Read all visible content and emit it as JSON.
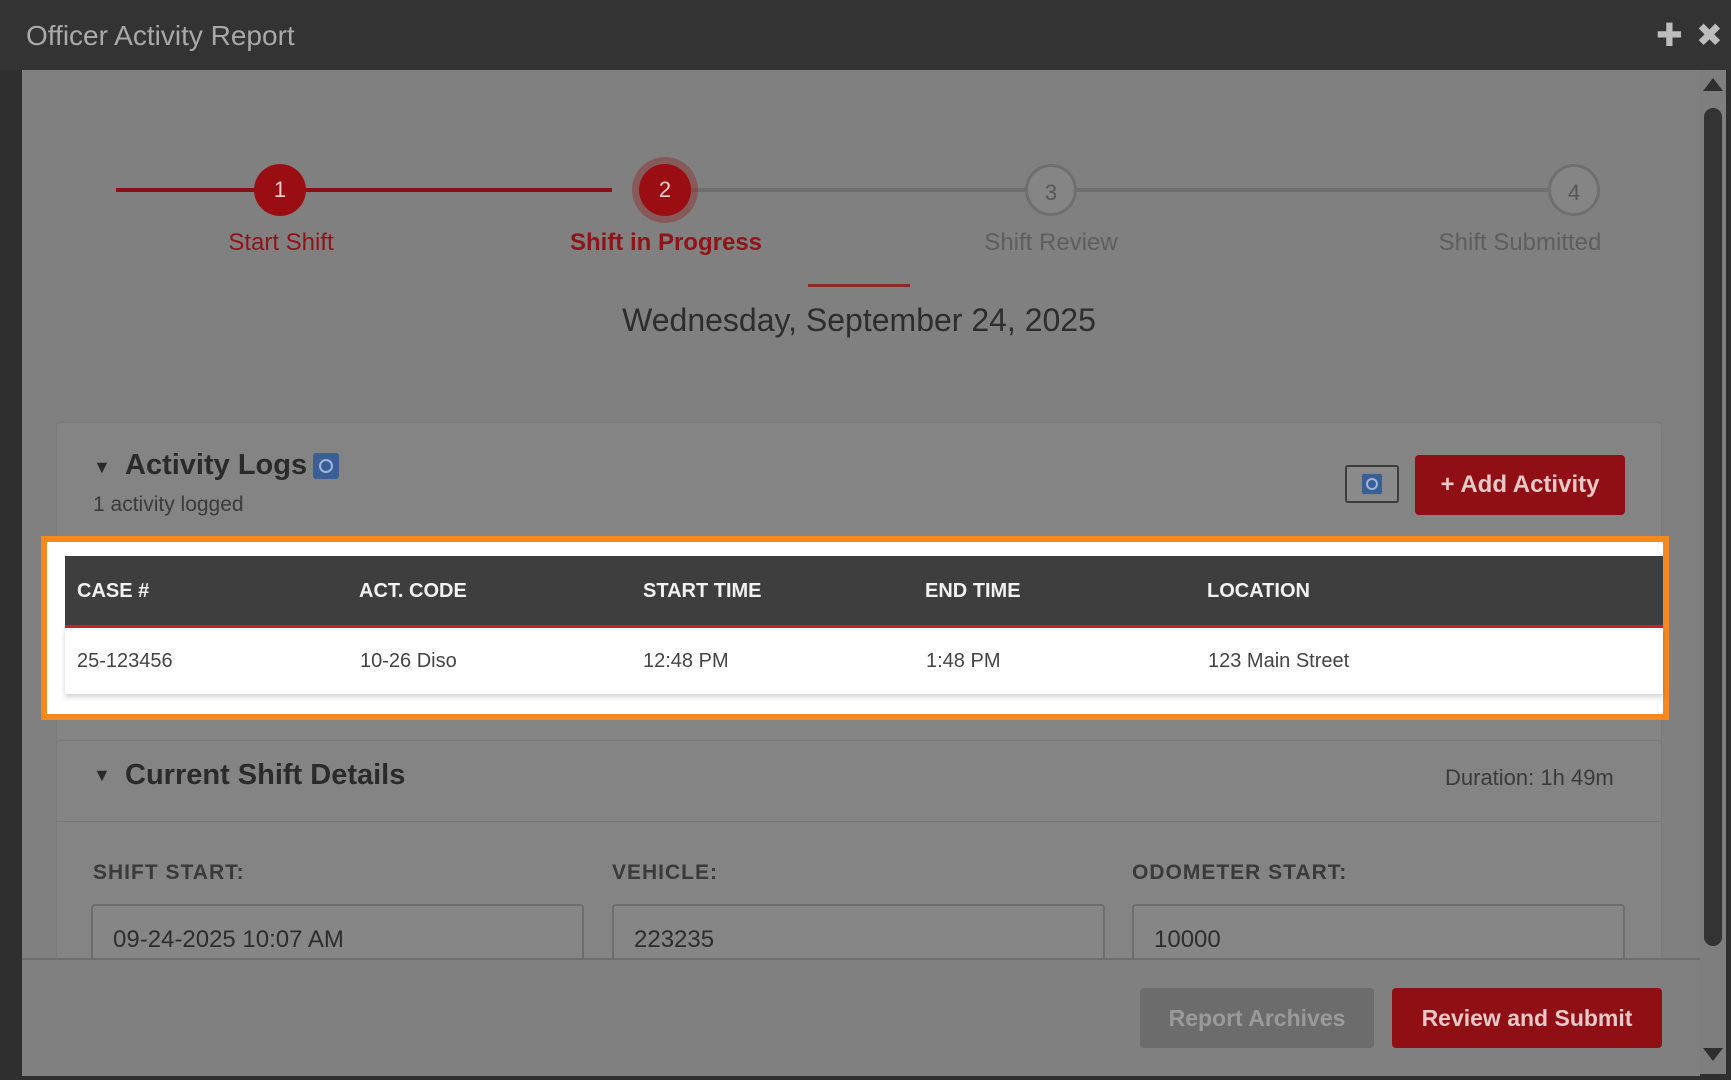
{
  "window": {
    "title": "Officer Activity Report"
  },
  "stepper": {
    "steps": [
      {
        "number": "1",
        "label": "Start Shift"
      },
      {
        "number": "2",
        "label": "Shift in Progress"
      },
      {
        "number": "3",
        "label": "Shift Review"
      },
      {
        "number": "4",
        "label": "Shift Submitted"
      }
    ],
    "current_step": 2
  },
  "date": "Wednesday, September 24, 2025",
  "activity_logs": {
    "title": "Activity Logs",
    "subtext": "1 activity logged",
    "add_button": "+ Add Activity",
    "columns": [
      "CASE #",
      "ACT. CODE",
      "START TIME",
      "END TIME",
      "LOCATION"
    ],
    "rows": [
      [
        "25-123456",
        "10-26 Diso",
        "12:48 PM",
        "1:48 PM",
        "123 Main Street"
      ]
    ]
  },
  "shift_details": {
    "title": "Current Shift Details",
    "duration": "Duration: 1h 49m",
    "fields": [
      {
        "label": "SHIFT START:",
        "value": "09-24-2025 10:07 AM"
      },
      {
        "label": "VEHICLE:",
        "value": "223235"
      },
      {
        "label": "ODOMETER START:",
        "value": "10000"
      }
    ]
  },
  "footer": {
    "archives_button": "Report Archives",
    "submit_button": "Review and Submit"
  },
  "colors": {
    "accent": "#8f0f14",
    "highlight": "#f5891f",
    "table_header": "#3e3e3e"
  }
}
